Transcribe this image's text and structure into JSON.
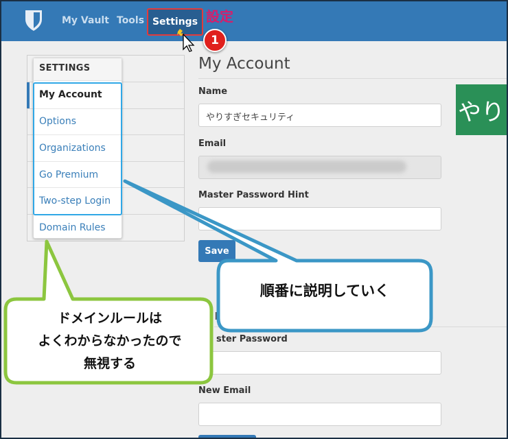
{
  "nav": {
    "my_vault": "My Vault",
    "tools": "Tools",
    "settings": "Settings"
  },
  "annotations": {
    "settings_label": "設定",
    "step_number": "1",
    "explain_in_order": "順番に説明していく",
    "domain_rules_note_line1": "ドメインルールは",
    "domain_rules_note_line2": "よくわからなかったので",
    "domain_rules_note_line3": "無視する"
  },
  "sidebar": {
    "heading": "SETTINGS",
    "items": [
      {
        "label": "My Account",
        "active": true
      },
      {
        "label": "Options",
        "active": false
      },
      {
        "label": "Organizations",
        "active": false
      },
      {
        "label": "Go Premium",
        "active": false
      },
      {
        "label": "Two-step Login",
        "active": false
      },
      {
        "label": "Domain Rules",
        "active": false
      }
    ]
  },
  "main": {
    "title": "My Account",
    "name_label": "Name",
    "name_value": "やりすぎセキュリティ",
    "email_label": "Email",
    "hint_label": "Master Password Hint",
    "hint_value": "",
    "save_label": "Save",
    "avatar_text": "やり",
    "master_password_label_partial": "ster Password",
    "new_email_label": "New Email"
  },
  "colors": {
    "nav_bg": "#3479b6",
    "nav_active_bg": "#285e91",
    "annotation_red": "#e53a3a",
    "annotation_pink": "#d61e6b",
    "sidebar_highlight": "#2fa7e6",
    "avatar_bg": "#2a9057",
    "callout_right_border": "#3b97c6",
    "callout_left_border": "#8cc63f"
  }
}
